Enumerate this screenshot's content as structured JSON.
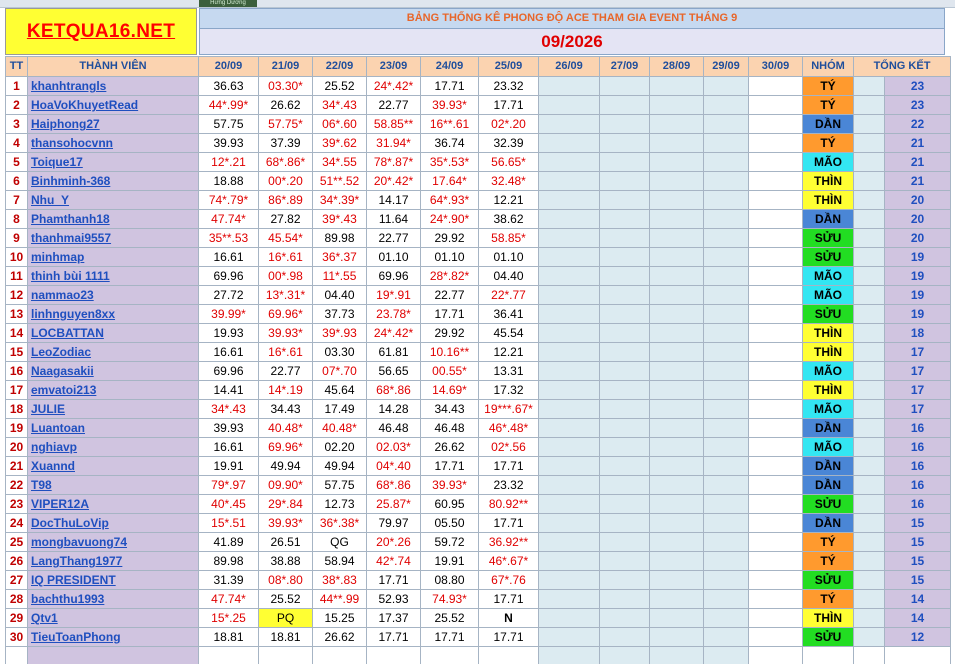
{
  "top_tab": "Hưng Dương",
  "logo": "KETQUA16.NET",
  "title": "BẢNG THỐNG KÊ PHONG ĐỘ ACE THAM GIA EVENT THÁNG 9",
  "month": "09/2026",
  "headers": {
    "tt": "TT",
    "member": "THÀNH VIÊN",
    "dates": [
      "20/09",
      "21/09",
      "22/09",
      "23/09",
      "24/09",
      "25/09",
      "26/09",
      "27/09",
      "28/09",
      "29/09",
      "30/09"
    ],
    "group": "NHÓM",
    "total": "TỔNG KẾT"
  },
  "rows": [
    {
      "tt": "1",
      "name": "khanhtrangls",
      "vals": [
        "36.63",
        "03.30*",
        "25.52",
        "24*.42*",
        "17.71",
        "23.32"
      ],
      "red": [
        0,
        1,
        0,
        1,
        0,
        0
      ],
      "group": "TÝ",
      "gclass": "g-ty",
      "total": "23"
    },
    {
      "tt": "2",
      "name": "HoaVoKhuyetRead",
      "vals": [
        "44*.99*",
        "26.62",
        "34*.43",
        "22.77",
        "39.93*",
        "17.71"
      ],
      "red": [
        1,
        0,
        1,
        0,
        1,
        0
      ],
      "group": "TÝ",
      "gclass": "g-ty",
      "total": "23"
    },
    {
      "tt": "3",
      "name": "Haiphong27",
      "vals": [
        "57.75",
        "57.75*",
        "06*.60",
        "58.85**",
        "16**.61",
        "02*.20"
      ],
      "red": [
        0,
        1,
        1,
        1,
        1,
        1
      ],
      "group": "DẦN",
      "gclass": "g-dan",
      "total": "22"
    },
    {
      "tt": "4",
      "name": "thansohocvnn",
      "vals": [
        "39.93",
        "37.39",
        "39*.62",
        "31.94*",
        "36.74",
        "32.39"
      ],
      "red": [
        0,
        0,
        1,
        1,
        0,
        0
      ],
      "group": "TÝ",
      "gclass": "g-ty",
      "total": "21"
    },
    {
      "tt": "5",
      "name": "Toique17",
      "vals": [
        "12*.21",
        "68*.86*",
        "34*.55",
        "78*.87*",
        "35*.53*",
        "56.65*"
      ],
      "red": [
        1,
        1,
        1,
        1,
        1,
        1
      ],
      "group": "MÃO",
      "gclass": "g-mao",
      "total": "21"
    },
    {
      "tt": "6",
      "name": "Binhminh-368",
      "vals": [
        "18.88",
        "00*.20",
        "51**.52",
        "20*.42*",
        "17.64*",
        "32.48*"
      ],
      "red": [
        0,
        1,
        1,
        1,
        1,
        1
      ],
      "group": "THÌN",
      "gclass": "g-thin",
      "total": "21"
    },
    {
      "tt": "7",
      "name": "Nhu_Y",
      "vals": [
        "74*.79*",
        "86*.89",
        "34*.39*",
        "14.17",
        "64*.93*",
        "12.21"
      ],
      "red": [
        1,
        1,
        1,
        0,
        1,
        0
      ],
      "group": "THÌN",
      "gclass": "g-thin",
      "total": "20"
    },
    {
      "tt": "8",
      "name": "Phamthanh18",
      "vals": [
        "47.74*",
        "27.82",
        "39*.43",
        "11.64",
        "24*.90*",
        "38.62"
      ],
      "red": [
        1,
        0,
        1,
        0,
        1,
        0
      ],
      "group": "DẦN",
      "gclass": "g-dan",
      "total": "20"
    },
    {
      "tt": "9",
      "name": "thanhmai9557",
      "vals": [
        "35**.53",
        "45.54*",
        "89.98",
        "22.77",
        "29.92",
        "58.85*"
      ],
      "red": [
        1,
        1,
        0,
        0,
        0,
        1
      ],
      "group": "SỬU",
      "gclass": "g-suu",
      "total": "20"
    },
    {
      "tt": "10",
      "name": "minhmap",
      "vals": [
        "16.61",
        "16*.61",
        "36*.37",
        "01.10",
        "01.10",
        "01.10"
      ],
      "red": [
        0,
        1,
        1,
        0,
        0,
        0
      ],
      "group": "SỬU",
      "gclass": "g-suu",
      "total": "19"
    },
    {
      "tt": "11",
      "name": "thinh bùi 1111",
      "vals": [
        "69.96",
        "00*.98",
        "11*.55",
        "69.96",
        "28*.82*",
        "04.40"
      ],
      "red": [
        0,
        1,
        1,
        0,
        1,
        0
      ],
      "group": "MÃO",
      "gclass": "g-mao",
      "total": "19"
    },
    {
      "tt": "12",
      "name": "nammao23",
      "vals": [
        "27.72",
        "13*.31*",
        "04.40",
        "19*.91",
        "22.77",
        "22*.77"
      ],
      "red": [
        0,
        1,
        0,
        1,
        0,
        1
      ],
      "group": "MÃO",
      "gclass": "g-mao",
      "total": "19"
    },
    {
      "tt": "13",
      "name": "linhnguyen8xx",
      "vals": [
        "39.99*",
        "69.96*",
        "37.73",
        "23.78*",
        "17.71",
        "36.41"
      ],
      "red": [
        1,
        1,
        0,
        1,
        0,
        0
      ],
      "group": "SỬU",
      "gclass": "g-suu",
      "total": "19"
    },
    {
      "tt": "14",
      "name": "LOCBATTAN",
      "vals": [
        "19.93",
        "39.93*",
        "39*.93",
        "24*.42*",
        "29.92",
        "45.54"
      ],
      "red": [
        0,
        1,
        1,
        1,
        0,
        0
      ],
      "group": "THÌN",
      "gclass": "g-thin",
      "total": "18"
    },
    {
      "tt": "15",
      "name": "LeoZodiac",
      "vals": [
        "16.61",
        "16*.61",
        "03.30",
        "61.81",
        "10.16**",
        "12.21"
      ],
      "red": [
        0,
        1,
        0,
        0,
        1,
        0
      ],
      "group": "THÌN",
      "gclass": "g-thin",
      "total": "17"
    },
    {
      "tt": "16",
      "name": "Naagasakii",
      "vals": [
        "69.96",
        "22.77",
        "07*.70",
        "56.65",
        "00.55*",
        "13.31"
      ],
      "red": [
        0,
        0,
        1,
        0,
        1,
        0
      ],
      "group": "MÃO",
      "gclass": "g-mao",
      "total": "17"
    },
    {
      "tt": "17",
      "name": "emvatoi213",
      "vals": [
        "14.41",
        "14*.19",
        "45.64",
        "68*.86",
        "14.69*",
        "17.32"
      ],
      "red": [
        0,
        1,
        0,
        1,
        1,
        0
      ],
      "group": "THÌN",
      "gclass": "g-thin",
      "total": "17"
    },
    {
      "tt": "18",
      "name": "JULIE",
      "vals": [
        "34*.43",
        "34.43",
        "17.49",
        "14.28",
        "34.43",
        "19***.67*"
      ],
      "red": [
        1,
        0,
        0,
        0,
        0,
        1
      ],
      "group": "MÃO",
      "gclass": "g-mao",
      "total": "17"
    },
    {
      "tt": "19",
      "name": "Luantoan",
      "vals": [
        "39.93",
        "40.48*",
        "40.48*",
        "46.48",
        "46.48",
        "46*.48*"
      ],
      "red": [
        0,
        1,
        1,
        0,
        0,
        1
      ],
      "group": "DẦN",
      "gclass": "g-dan",
      "total": "16"
    },
    {
      "tt": "20",
      "name": "nghiavp",
      "vals": [
        "16.61",
        "69.96*",
        "02.20",
        "02.03*",
        "26.62",
        "02*.56"
      ],
      "red": [
        0,
        1,
        0,
        1,
        0,
        1
      ],
      "group": "MÃO",
      "gclass": "g-mao",
      "total": "16"
    },
    {
      "tt": "21",
      "name": "Xuannd",
      "vals": [
        "19.91",
        "49.94",
        "49.94",
        "04*.40",
        "17.71",
        "17.71"
      ],
      "red": [
        0,
        0,
        0,
        1,
        0,
        0
      ],
      "group": "DẦN",
      "gclass": "g-dan",
      "total": "16"
    },
    {
      "tt": "22",
      "name": "T98",
      "vals": [
        "79*.97",
        "09.90*",
        "57.75",
        "68*.86",
        "39.93*",
        "23.32"
      ],
      "red": [
        1,
        1,
        0,
        1,
        1,
        0
      ],
      "group": "DẦN",
      "gclass": "g-dan",
      "total": "16"
    },
    {
      "tt": "23",
      "name": "VIPER12A",
      "vals": [
        "40*.45",
        "29*.84",
        "12.73",
        "25.87*",
        "60.95",
        "80.92**"
      ],
      "red": [
        1,
        1,
        0,
        1,
        0,
        1
      ],
      "group": "SỬU",
      "gclass": "g-suu",
      "total": "16"
    },
    {
      "tt": "24",
      "name": "DocThuLoVip",
      "vals": [
        "15*.51",
        "39.93*",
        "36*.38*",
        "79.97",
        "05.50",
        "17.71"
      ],
      "red": [
        1,
        1,
        1,
        0,
        0,
        0
      ],
      "group": "DẦN",
      "gclass": "g-dan",
      "total": "15"
    },
    {
      "tt": "25",
      "name": "mongbavuong74",
      "vals": [
        "41.89",
        "26.51",
        "QG",
        "20*.26",
        "59.72",
        "36.92**"
      ],
      "red": [
        0,
        0,
        0,
        1,
        0,
        1
      ],
      "group": "TÝ",
      "gclass": "g-ty",
      "total": "15"
    },
    {
      "tt": "26",
      "name": "LangThang1977",
      "vals": [
        "89.98",
        "38.88",
        "58.94",
        "42*.74",
        "19.91",
        "46*.67*"
      ],
      "red": [
        0,
        0,
        0,
        1,
        0,
        1
      ],
      "group": "TÝ",
      "gclass": "g-ty",
      "total": "15"
    },
    {
      "tt": "27",
      "name": "IQ PRESIDENT",
      "vals": [
        "31.39",
        "08*.80",
        "38*.83",
        "17.71",
        "08.80",
        "67*.76"
      ],
      "red": [
        0,
        1,
        1,
        0,
        0,
        1
      ],
      "group": "SỬU",
      "gclass": "g-suu",
      "total": "15"
    },
    {
      "tt": "28",
      "name": "bachthu1993",
      "vals": [
        "47.74*",
        "25.52",
        "44**.99",
        "52.93",
        "74.93*",
        "17.71"
      ],
      "red": [
        1,
        0,
        1,
        0,
        1,
        0
      ],
      "group": "TÝ",
      "gclass": "g-ty",
      "total": "14"
    },
    {
      "tt": "29",
      "name": "Qtv1",
      "vals": [
        "15*.25",
        "PQ",
        "15.25",
        "17.37",
        "25.52",
        "N"
      ],
      "red": [
        1,
        0,
        0,
        0,
        0,
        0
      ],
      "group": "THÌN",
      "gclass": "g-thin",
      "total": "14"
    },
    {
      "tt": "30",
      "name": "TieuToanPhong",
      "vals": [
        "18.81",
        "18.81",
        "26.62",
        "17.71",
        "17.71",
        "17.71"
      ],
      "red": [
        0,
        0,
        0,
        0,
        0,
        0
      ],
      "group": "SỬU",
      "gclass": "g-suu",
      "total": "12"
    }
  ]
}
